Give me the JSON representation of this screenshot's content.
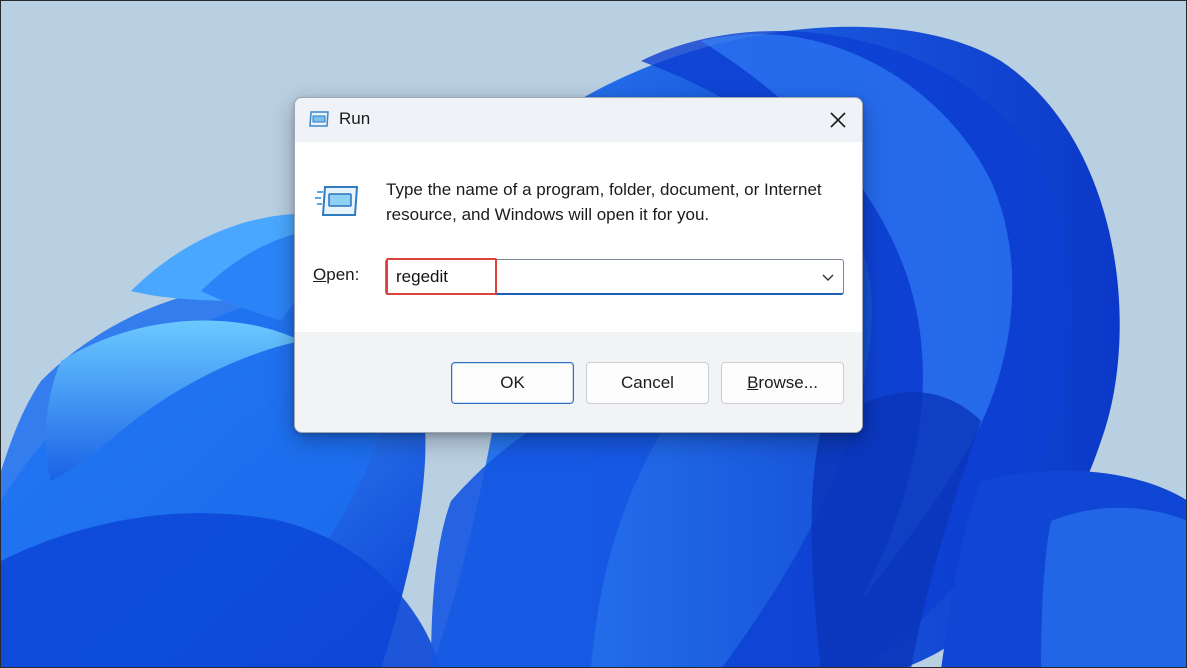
{
  "window": {
    "title": "Run",
    "description": "Type the name of a program, folder, document, or Internet resource, and Windows will open it for you.",
    "open_label_accel": "O",
    "open_label_rest": "pen:",
    "open_value": "regedit"
  },
  "buttons": {
    "ok_label": "OK",
    "cancel_label": "Cancel",
    "browse_accel": "B",
    "browse_rest": "rowse..."
  },
  "icons": {
    "title": "run-app-icon",
    "content": "run-app-icon-large",
    "close": "close-icon",
    "dropdown": "chevron-down-icon"
  },
  "colors": {
    "accent": "#1d5fb8",
    "highlight": "#e0403b",
    "wallpaper": "#1f5fe0"
  }
}
